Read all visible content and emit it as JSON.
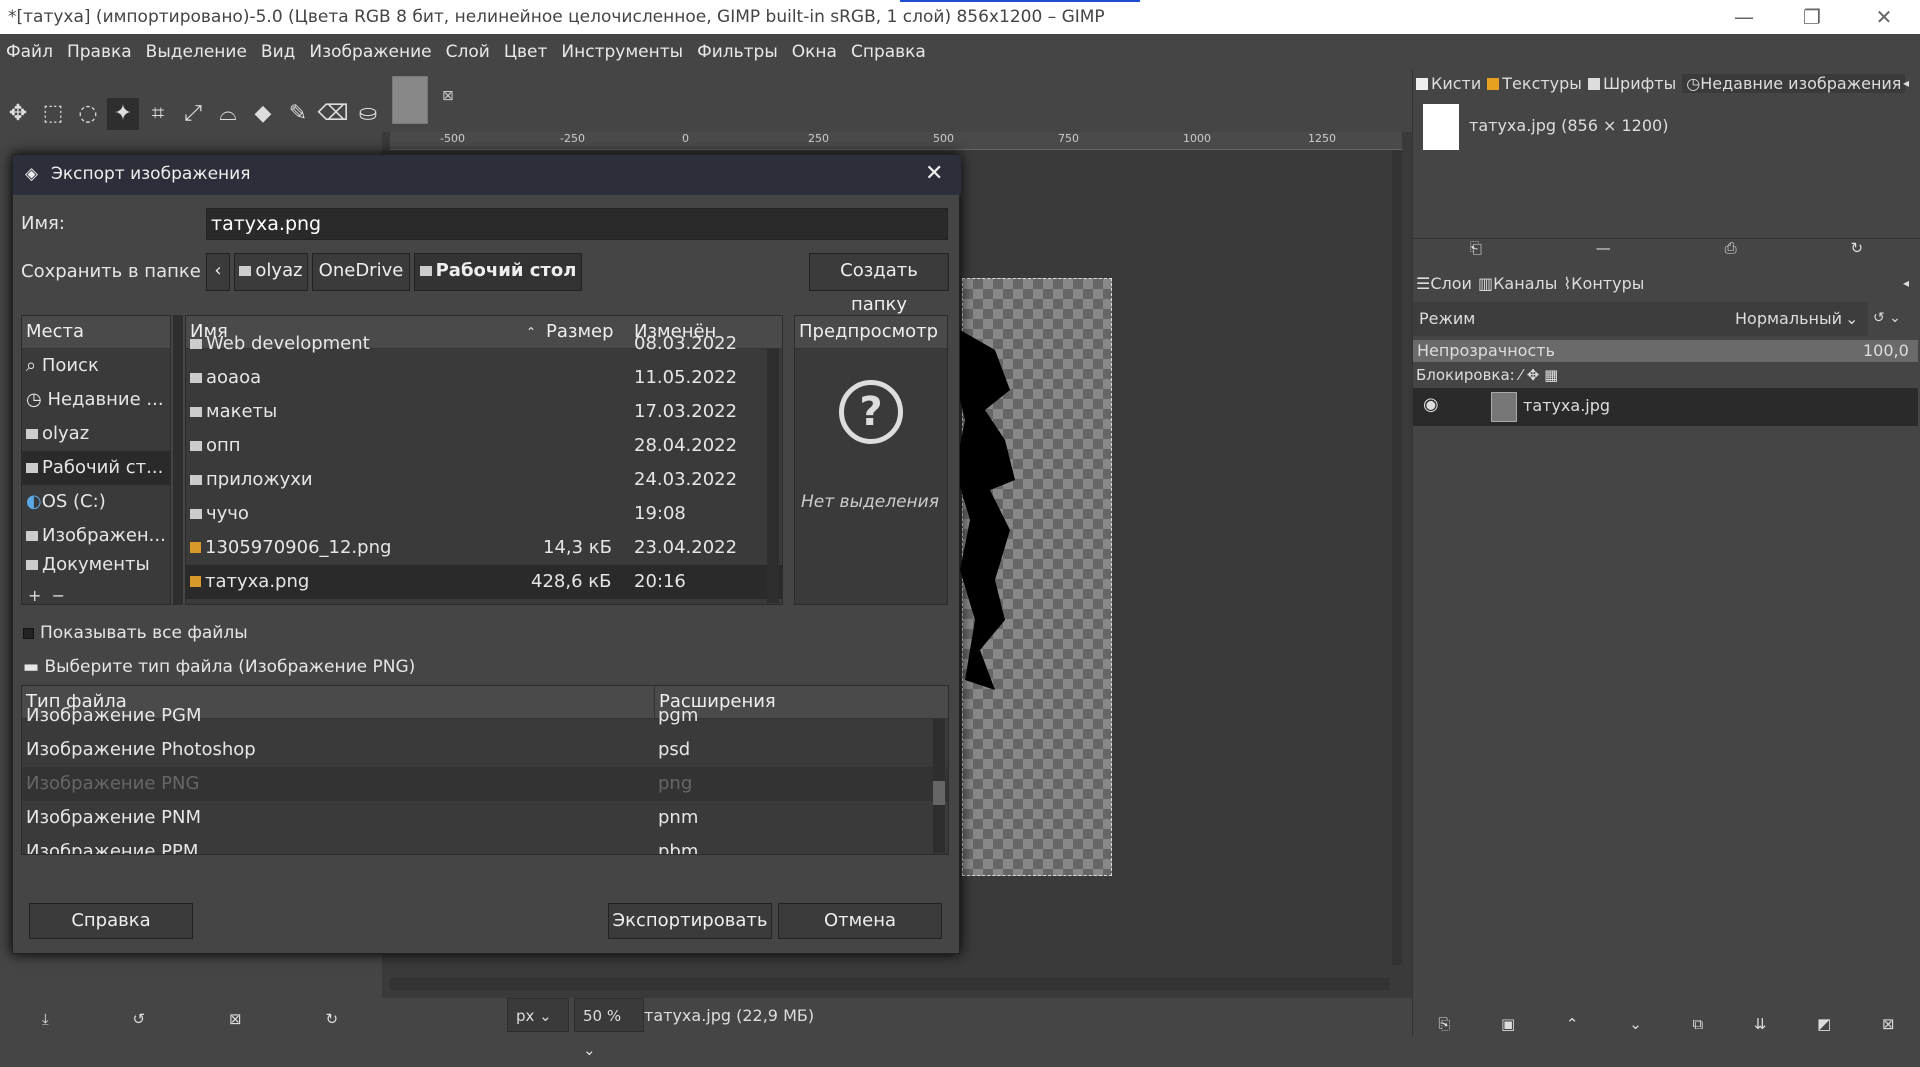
{
  "window": {
    "title": "*[татуха] (импортировано)-5.0 (Цвета RGB 8 бит, нелинейное целочисленное, GIMP built-in sRGB, 1 слой) 856x1200 – GIMP",
    "minimize": "—",
    "maximize": "❐",
    "close": "✕"
  },
  "menu": [
    "Файл",
    "Правка",
    "Выделение",
    "Вид",
    "Изображение",
    "Слой",
    "Цвет",
    "Инструменты",
    "Фильтры",
    "Окна",
    "Справка"
  ],
  "ruler_ticks": [
    "-500",
    "-250",
    "0",
    "250",
    "500",
    "750",
    "1000",
    "1250"
  ],
  "statusbar": {
    "unit": "px",
    "zoom": "50 %",
    "info": "татуха.jpg (22,9 МБ)"
  },
  "dock_top": {
    "tabs": [
      "Кисти",
      "Текстуры",
      "Шрифты",
      "Недавние изображения"
    ],
    "recent_item": "татуха.jpg (856 × 1200)"
  },
  "dock_layers": {
    "tabs": [
      "Слои",
      "Каналы",
      "Контуры"
    ],
    "mode_label": "Режим",
    "mode_value": "Нормальный",
    "opacity_label": "Непрозрачность",
    "opacity_value": "100,0",
    "lock_label": "Блокировка:",
    "layer_name": "татуха.jpg"
  },
  "dialog": {
    "title": "Экспорт изображения",
    "name_label": "Имя:",
    "name_value": "татуха.png",
    "folder_label": "Сохранить в папке",
    "path": [
      "olyaz",
      "OneDrive",
      "Рабочий стол"
    ],
    "create_folder": "Создать папку",
    "places_header": "Места",
    "places": [
      "Поиск",
      "Недавние ...",
      "olyaz",
      "Рабочий ст...",
      "OS (C:)",
      "Изображен...",
      "Документы"
    ],
    "cols": {
      "name": "Имя",
      "size": "Размер",
      "modified": "Изменён"
    },
    "files": [
      {
        "name": "Web development",
        "size": "",
        "date": "08.03.2022",
        "type": "folder"
      },
      {
        "name": "аоаоа",
        "size": "",
        "date": "11.05.2022",
        "type": "folder"
      },
      {
        "name": "макеты",
        "size": "",
        "date": "17.03.2022",
        "type": "folder"
      },
      {
        "name": "опп",
        "size": "",
        "date": "28.04.2022",
        "type": "folder"
      },
      {
        "name": "приложухи",
        "size": "",
        "date": "24.03.2022",
        "type": "folder"
      },
      {
        "name": "чучо",
        "size": "",
        "date": "19:08",
        "type": "folder"
      },
      {
        "name": "1305970906_12.png",
        "size": "14,3 кБ",
        "date": "23.04.2022",
        "type": "png"
      },
      {
        "name": "татуха.png",
        "size": "428,6 кБ",
        "date": "20:16",
        "type": "png"
      }
    ],
    "preview_header": "Предпросмотр",
    "no_selection": "Нет выделения",
    "show_all": "Показывать все файлы",
    "filetype_toggle": "Выберите тип файла (Изображение PNG)",
    "type_cols": {
      "type": "Тип файла",
      "ext": "Расширения"
    },
    "types": [
      {
        "type": "Изображение PGM",
        "ext": "pgm"
      },
      {
        "type": "Изображение Photoshop",
        "ext": "psd"
      },
      {
        "type": "Изображение PNG",
        "ext": "png"
      },
      {
        "type": "Изображение PNM",
        "ext": "pnm"
      },
      {
        "type": "Изображение PPM",
        "ext": "pbm"
      }
    ],
    "help": "Справка",
    "export": "Экспортировать",
    "cancel": "Отмена"
  }
}
